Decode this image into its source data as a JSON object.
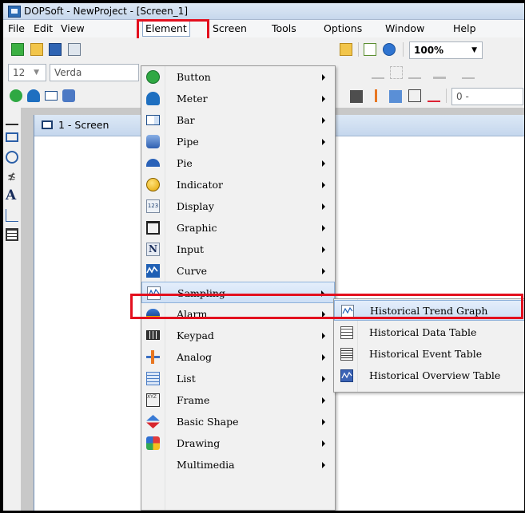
{
  "window": {
    "title": "DOPSoft - NewProject - [Screen_1]"
  },
  "menubar": {
    "items": [
      "File",
      "Edit",
      "View",
      "Element",
      "Screen",
      "Tools",
      "Options",
      "Window",
      "Help"
    ],
    "active": "Element"
  },
  "toolbar": {
    "zoom": "100%",
    "font_size": "12",
    "font_name": "Verda",
    "range_field": "0 -"
  },
  "document": {
    "tab_title": "1 - Screen"
  },
  "element_menu": {
    "items": [
      {
        "label": "Button",
        "icon": "button-icon"
      },
      {
        "label": "Meter",
        "icon": "meter-icon"
      },
      {
        "label": "Bar",
        "icon": "bar-icon"
      },
      {
        "label": "Pipe",
        "icon": "pipe-icon"
      },
      {
        "label": "Pie",
        "icon": "pie-icon"
      },
      {
        "label": "Indicator",
        "icon": "indicator-icon"
      },
      {
        "label": "Display",
        "icon": "display-icon"
      },
      {
        "label": "Graphic",
        "icon": "graphic-icon"
      },
      {
        "label": "Input",
        "icon": "input-icon"
      },
      {
        "label": "Curve",
        "icon": "curve-icon"
      },
      {
        "label": "Sampling",
        "icon": "sampling-icon"
      },
      {
        "label": "Alarm",
        "icon": "alarm-icon"
      },
      {
        "label": "Keypad",
        "icon": "keypad-icon"
      },
      {
        "label": "Analog",
        "icon": "analog-icon"
      },
      {
        "label": "List",
        "icon": "list-icon"
      },
      {
        "label": "Frame",
        "icon": "frame-icon"
      },
      {
        "label": "Basic Shape",
        "icon": "basic-shape-icon"
      },
      {
        "label": "Drawing",
        "icon": "drawing-icon"
      },
      {
        "label": "Multimedia",
        "icon": "multimedia-icon"
      }
    ],
    "highlighted": "Sampling"
  },
  "sampling_submenu": {
    "items": [
      {
        "label": "Historical Trend Graph",
        "icon": "trend-graph-icon"
      },
      {
        "label": "Historical Data Table",
        "icon": "data-table-icon"
      },
      {
        "label": "Historical Event Table",
        "icon": "event-table-icon"
      },
      {
        "label": "Historical Overview Table",
        "icon": "overview-table-icon"
      }
    ],
    "highlighted": "Historical Trend Graph"
  },
  "colors": {
    "highlight_box": "#e3101e",
    "menu_highlight": "#cddff5",
    "title_gradient": "#c6d7ec"
  }
}
